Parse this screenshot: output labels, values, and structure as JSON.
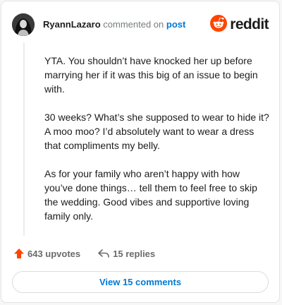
{
  "header": {
    "username": "RyannLazaro",
    "action_text": "commented on",
    "target_text": "post",
    "logo_text": "reddit"
  },
  "comment": {
    "paragraphs": [
      "YTA. You shouldn’t have knocked her up before marrying her if it was this big of an issue to begin with.",
      "30 weeks? What’s she supposed to wear to hide it? A moo moo? I’d absolutely want to wear a dress that compliments my belly.",
      "As for your family who aren’t happy with how you’ve done things… tell them to feel free to skip the wedding. Good vibes and supportive loving family only."
    ]
  },
  "actions": {
    "upvotes_label": "643 upvotes",
    "replies_label": "15 replies"
  },
  "footer": {
    "view_comments_label": "View 15 comments"
  },
  "colors": {
    "brand": "#ff4500",
    "link": "#0079d3",
    "text": "#1c1c1c",
    "muted": "#787c7e"
  },
  "icons": {
    "avatar": "user-avatar-photo",
    "logo": "reddit-snoo-logo",
    "upvote": "upvote-arrow-icon",
    "reply": "reply-arrow-icon"
  }
}
